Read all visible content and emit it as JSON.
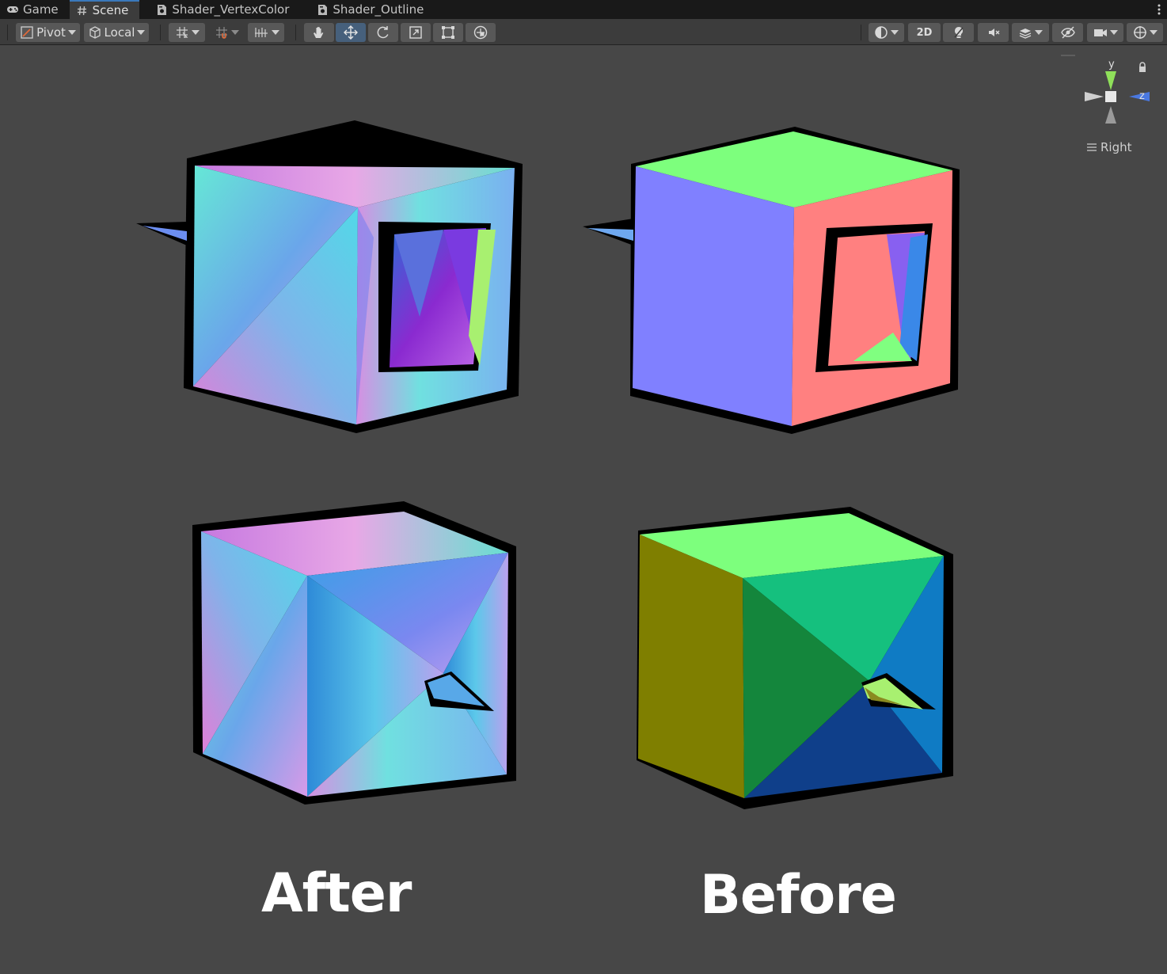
{
  "tabs": [
    {
      "label": "Game",
      "icon": "gamepad-icon",
      "active": false
    },
    {
      "label": "Scene",
      "icon": "hash-icon",
      "active": true
    },
    {
      "label": "Shader_VertexColor",
      "icon": "shader-file-icon",
      "active": false
    },
    {
      "label": "Shader_Outline",
      "icon": "shader-file-icon",
      "active": false
    }
  ],
  "toolbar": {
    "pivot_label": "Pivot",
    "local_label": "Local",
    "toggle_2d_label": "2D",
    "tools": [
      "hand-tool-icon",
      "move-tool-icon",
      "rotate-tool-icon",
      "scale-tool-icon",
      "rect-tool-icon",
      "transform-tool-icon"
    ],
    "active_tool": "move-tool-icon"
  },
  "gizmo": {
    "y_label": "y",
    "z_label": "z",
    "view_label": "Right"
  },
  "captions": {
    "left": "After",
    "right": "Before"
  },
  "colors": {
    "background": "#474747",
    "active_tool": "#46607c",
    "axis_y": "#8fe05a",
    "axis_z": "#4a78e0"
  }
}
